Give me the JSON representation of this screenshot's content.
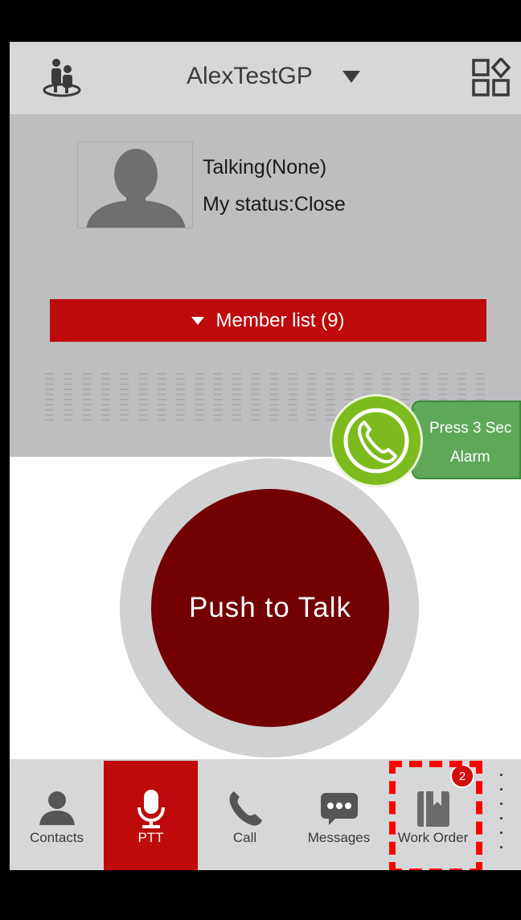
{
  "header": {
    "title": "AlexTestGP",
    "left_icon": "group-users-icon",
    "right_icon": "apps-grid-icon"
  },
  "status": {
    "talking": "Talking(None)",
    "my_status": "My status:Close"
  },
  "member_list": {
    "label": "Member list (9)"
  },
  "alarm": {
    "line1": "Press 3 Sec",
    "line2": "Alarm",
    "icon": "phone-icon"
  },
  "ptt": {
    "label": "Push to Talk"
  },
  "nav": {
    "items": [
      {
        "label": "Contacts",
        "icon": "person-icon"
      },
      {
        "label": "PTT",
        "icon": "microphone-icon"
      },
      {
        "label": "Call",
        "icon": "phone-icon"
      },
      {
        "label": "Messages",
        "icon": "chat-bubble-icon"
      },
      {
        "label": "Work Order",
        "icon": "book-icon"
      }
    ],
    "work_order_badge": "2"
  },
  "colors": {
    "accent_red": "#be0a0a",
    "ptt_dark_red": "#730000",
    "alarm_green": "#7cbb1d"
  }
}
